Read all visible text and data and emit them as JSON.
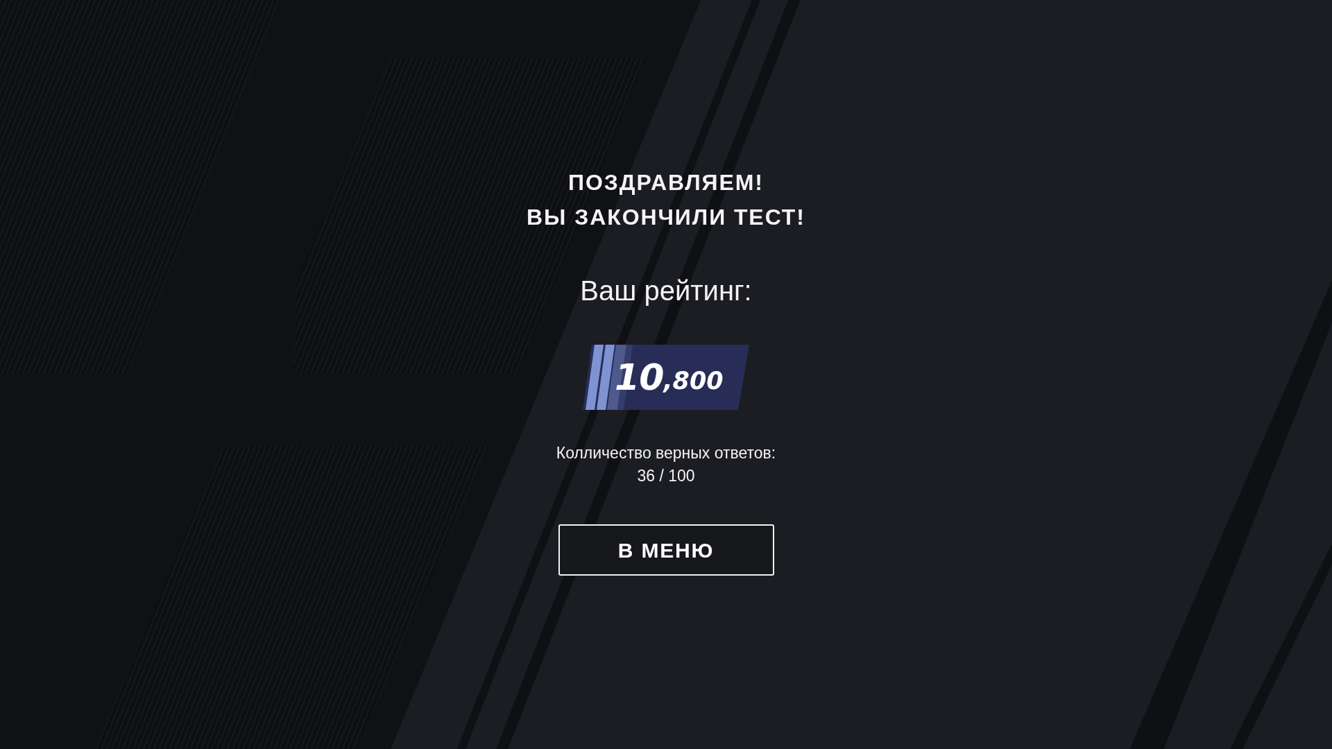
{
  "title": {
    "lines": [
      "ПОЗДРАВЛЯЕМ!",
      "ВЫ ЗАКОНЧИЛИ ТЕСТ!"
    ]
  },
  "rating": {
    "label": "Ваш рейтинг:",
    "score": {
      "whole": "10",
      "fraction": ",800"
    }
  },
  "correct_answers": {
    "label": "Колличество верных ответов:",
    "value": "36 / 100"
  },
  "menu_button": {
    "label": "В МЕНЮ"
  }
}
